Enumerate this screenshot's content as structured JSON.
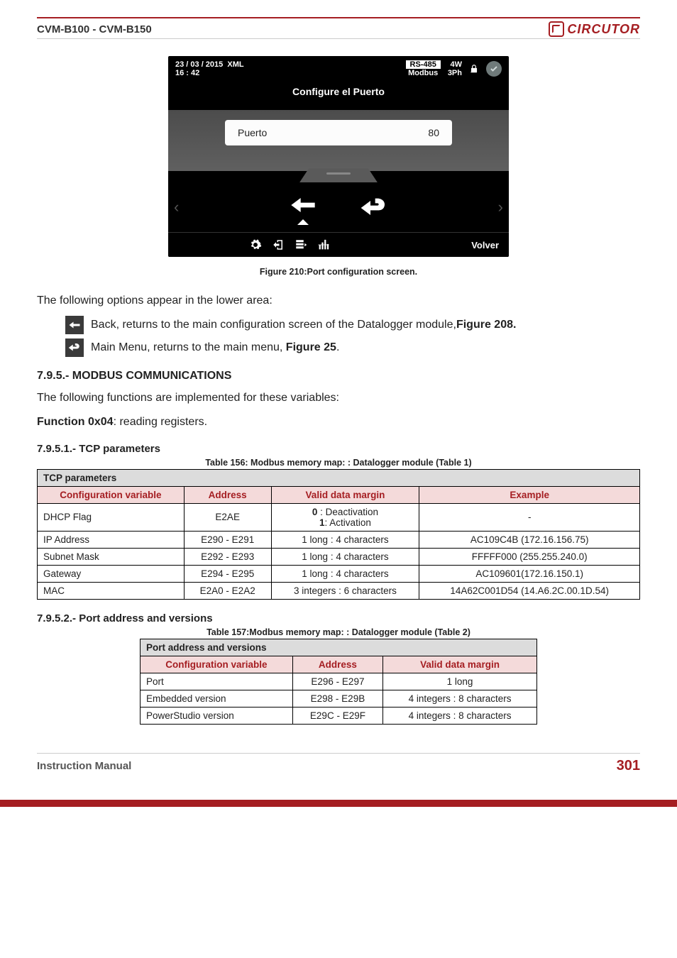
{
  "header": {
    "doc_title": "CVM-B100 - CVM-B150",
    "brand": "CIRCUTOR"
  },
  "device": {
    "datetime_line1": "23 / 03 / 2015",
    "datetime_line2": "16 : 42",
    "xml": "XML",
    "rs": "RS-485",
    "modbus": "Modbus",
    "ph_line1": "4W",
    "ph_line2": "3Ph",
    "screen_title": "Configure el Puerto",
    "field_label": "Puerto",
    "field_value": "80",
    "return_label": "Volver"
  },
  "fig_caption": "Figure 210:Port configuration screen.",
  "para_intro": "The following options appear in the lower area:",
  "icon_back_text_a": " Back, returns to the main configuration screen of the Datalogger module,",
  "icon_back_text_b": "Figure 208.",
  "icon_menu_text_a": " Main Menu, returns to the main menu, ",
  "icon_menu_text_b": "Figure 25",
  "icon_menu_text_c": ".",
  "sec_modbus": "7.9.5.- MODBUS COMMUNICATIONS",
  "para_modbus1": "The following functions are implemented for these variables:",
  "para_modbus2a": " Function 0x04",
  "para_modbus2b": ": reading registers.",
  "sub_tcp": "7.9.5.1.- TCP parameters",
  "tbl156_caption": "Table 156: Modbus memory map: : Datalogger  module (Table 1)",
  "tbl156": {
    "cat": "TCP parameters",
    "cols": [
      "Configuration variable",
      "Address",
      "Valid data margin",
      "Example"
    ],
    "rows": [
      {
        "v": "DHCP Flag",
        "a": "E2AE",
        "m_html": "<b>0</b> : Deactivation<br><b>1</b>: Activation",
        "e": "-"
      },
      {
        "v": "IP Address",
        "a": "E290 - E291",
        "m": "1 long : 4 characters",
        "e": "AC109C4B (172.16.156.75)"
      },
      {
        "v": "Subnet Mask",
        "a": "E292 - E293",
        "m": "1 long : 4 characters",
        "e": "FFFFF000 (255.255.240.0)"
      },
      {
        "v": "Gateway",
        "a": "E294 - E295",
        "m": "1 long : 4 characters",
        "e": "AC109601(172.16.150.1)"
      },
      {
        "v": "MAC",
        "a": "E2A0 - E2A2",
        "m": "3 integers : 6 characters",
        "e": "14A62C001D54 (14.A6.2C.00.1D.54)"
      }
    ]
  },
  "sub_port": "7.9.5.2.-  Port address and versions",
  "tbl157_caption": "Table 157:Modbus memory map: : Datalogger  module (Table 2)",
  "tbl157": {
    "cat": "Port address and versions",
    "cols": [
      "Configuration variable",
      "Address",
      "Valid data margin"
    ],
    "rows": [
      {
        "v": "Port",
        "a": "E296 - E297",
        "m": "1 long"
      },
      {
        "v": "Embedded version",
        "a": "E298 - E29B",
        "m": "4 integers : 8 characters"
      },
      {
        "v": "PowerStudio version",
        "a": "E29C - E29F",
        "m": "4 integers : 8 characters"
      }
    ]
  },
  "footer": {
    "manual": "Instruction Manual",
    "page": "301"
  }
}
